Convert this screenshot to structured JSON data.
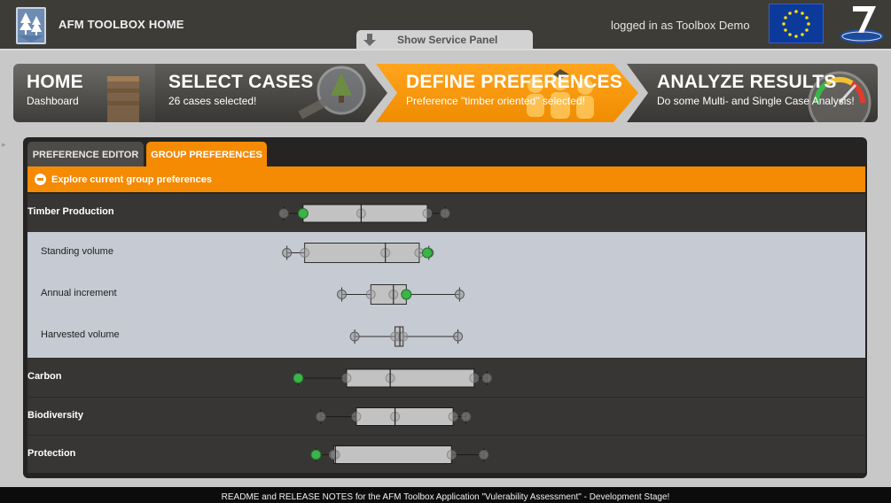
{
  "header": {
    "app_title": "AFM TOOLBOX HOME",
    "login_text": "logged in as Toolbox Demo",
    "service_panel_label": "Show Service Panel",
    "logo_icon": "tree-shield-icon",
    "eu_flag_icon": "eu-flag-icon",
    "fp7_logo_icon": "fp7-logo-icon"
  },
  "wizard": [
    {
      "title": "HOME",
      "subtitle": "Dashboard"
    },
    {
      "title": "SELECT CASES",
      "subtitle": "26 cases selected!"
    },
    {
      "title": "DEFINE PREFERENCES",
      "subtitle": "Preference \"timber oriented\" selected!"
    },
    {
      "title": "ANALYZE RESULTS",
      "subtitle": "Do some Multi- and Single Case Analysis!"
    }
  ],
  "tabs": {
    "editor": "PREFERENCE EDITOR",
    "group": "GROUP PREFERENCES",
    "active": "group"
  },
  "section": {
    "label": "Explore current group preferences"
  },
  "colors": {
    "accent": "#f58a03",
    "highlight_marker": "#39b54a"
  },
  "chart_data": {
    "type": "boxplot",
    "rows": [
      {
        "label": "Timber Production",
        "level": 0,
        "whisker_low": 0.0,
        "q1": 0.12,
        "median": 0.48,
        "q3": 0.89,
        "whisker_high": 1.0,
        "marker": 0.12
      },
      {
        "label": "Standing volume",
        "level": 1,
        "whisker_low": 0.02,
        "q1": 0.13,
        "median": 0.63,
        "q3": 0.84,
        "whisker_high": 0.9,
        "marker": 0.89
      },
      {
        "label": "Annual increment",
        "level": 1,
        "whisker_low": 0.36,
        "q1": 0.54,
        "median": 0.68,
        "q3": 0.76,
        "whisker_high": 1.09,
        "marker": 0.76
      },
      {
        "label": "Harvested volume",
        "level": 1,
        "whisker_low": 0.44,
        "q1": 0.69,
        "median": 0.72,
        "q3": 0.74,
        "whisker_high": 1.08,
        "marker": null
      },
      {
        "label": "Carbon",
        "level": 0,
        "whisker_low": 0.09,
        "q1": 0.39,
        "median": 0.66,
        "q3": 1.18,
        "whisker_high": 1.26,
        "marker": 0.09
      },
      {
        "label": "Biodiversity",
        "level": 0,
        "whisker_low": 0.23,
        "q1": 0.45,
        "median": 0.69,
        "q3": 1.05,
        "whisker_high": 1.13,
        "marker": null
      },
      {
        "label": "Protection",
        "level": 0,
        "whisker_low": 0.2,
        "q1": 0.31,
        "median": 0.32,
        "q3": 1.04,
        "whisker_high": 1.24,
        "marker": 0.2
      }
    ]
  },
  "footer": {
    "text": "README and RELEASE NOTES for the AFM Toolbox Application \"Vulerability Assessment\" - Development Stage!"
  }
}
